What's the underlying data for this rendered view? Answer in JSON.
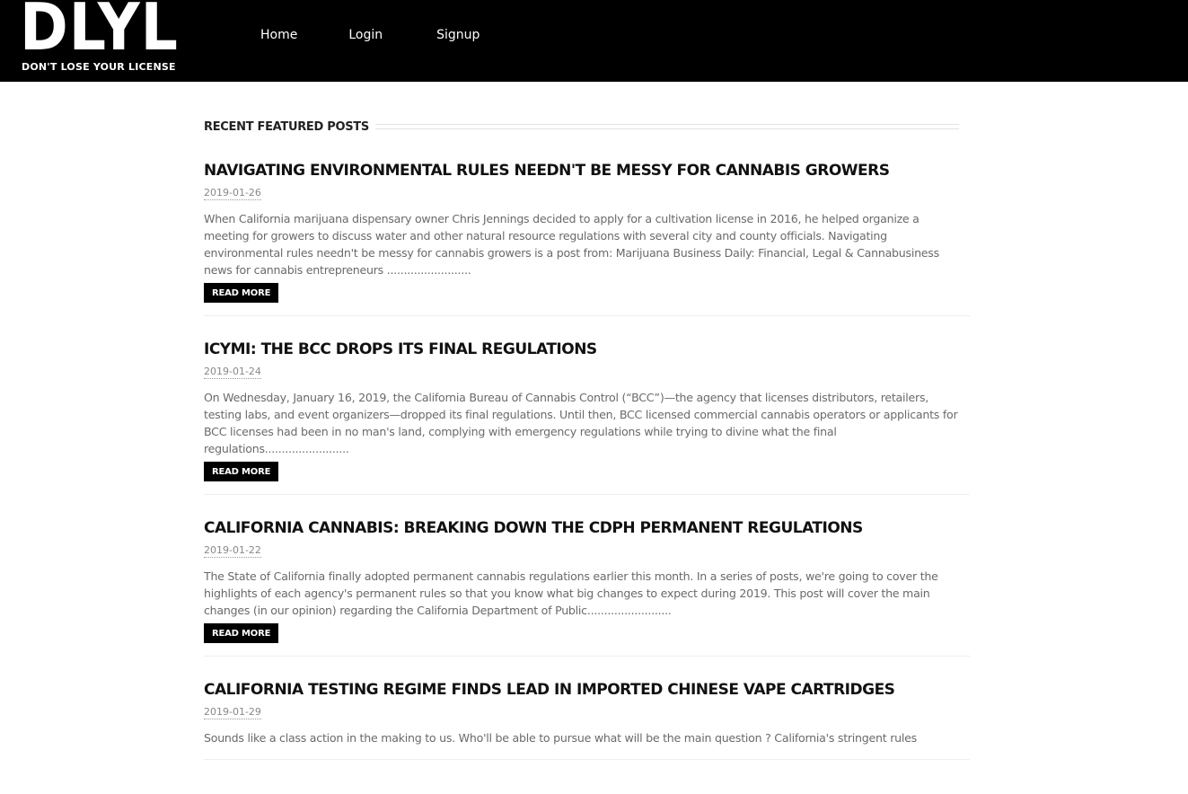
{
  "header": {
    "logo_text": "DLYL",
    "logo_tagline": "DON'T LOSE YOUR LICENSE",
    "nav": [
      {
        "label": "Home"
      },
      {
        "label": "Login"
      },
      {
        "label": "Signup"
      }
    ]
  },
  "main": {
    "section_title": "RECENT FEATURED POSTS",
    "read_more_label": "READ MORE",
    "posts": [
      {
        "title": "Navigating environmental rules needn't be messy for cannabis growers",
        "date": "2019-01-26",
        "excerpt": "When California marijuana dispensary owner Chris Jennings decided to apply for a cultivation license in 2016, he helped organize a meeting for growers to discuss water and other natural resource regulations with several city and county officials. Navigating environmental rules needn't be messy for cannabis growers is a post from: Marijuana Business Daily: Financial, Legal & Cannabusiness news for cannabis entrepreneurs ........................."
      },
      {
        "title": "ICYMI: The BCC Drops Its Final Regulations",
        "date": "2019-01-24",
        "excerpt": "On Wednesday, January 16, 2019, the California Bureau of Cannabis Control (“BCC”)—the agency that licenses distributors, retailers, testing labs, and event organizers—dropped its final regulations. Until then, BCC licensed commercial cannabis operators or applicants for BCC licenses had been in no man's land, complying with emergency regulations while trying to divine what the final regulations........................."
      },
      {
        "title": "California Cannabis: Breaking Down the CDPH Permanent Regulations",
        "date": "2019-01-22",
        "excerpt": "The State of California finally adopted permanent cannabis regulations earlier this month. In a series of posts, we're going to cover the highlights of each agency's permanent rules so that you know what big changes to expect during 2019. This post will cover the main changes (in our opinion) regarding the California Department of Public........................."
      },
      {
        "title": "California Testing Regime Finds Lead in Imported Chinese Vape Cartridges",
        "date": "2019-01-29",
        "excerpt": "Sounds like a class action in the making to us. Who'll be able to pursue what will be the main question ? California's stringent rules"
      }
    ]
  }
}
